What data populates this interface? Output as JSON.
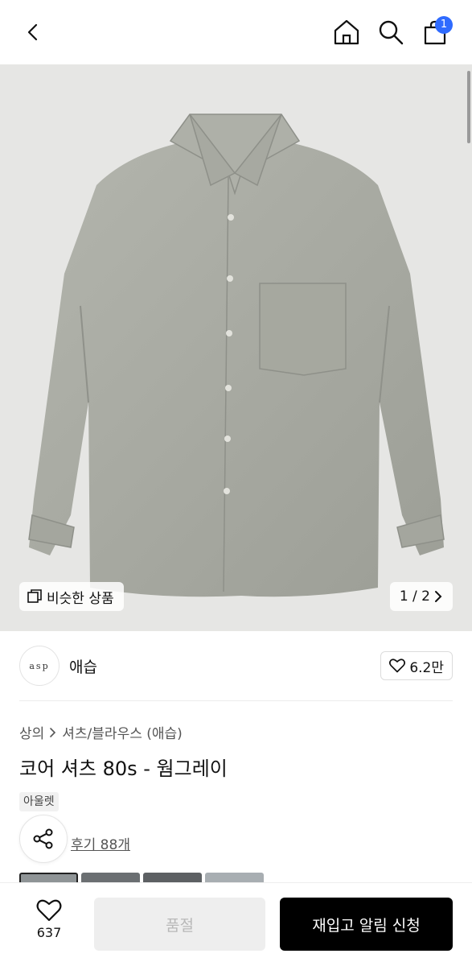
{
  "header": {
    "cart_count": "1"
  },
  "hero": {
    "similar_label": "비슷한 상품",
    "page_indicator": "1 / 2"
  },
  "brand": {
    "logo_text": "asp",
    "name": "애습",
    "like_count": "6.2만"
  },
  "breadcrumb": {
    "category": "상의",
    "subcategory": "셔츠/블라우스 (애습)"
  },
  "product": {
    "title": "코어 셔츠 80s - 웜그레이",
    "tag": "아울렛",
    "review_link": "후기 88개"
  },
  "bottom_bar": {
    "wish_count": "637",
    "soldout_label": "품절",
    "restock_label": "재입고 알림 신청"
  },
  "colors": {
    "badge": "#2f6bff",
    "primary_button": "#000000",
    "disabled_button": "#eeeeee",
    "hero_background": "#e6e6e4",
    "shirt": "#a9aba2"
  }
}
